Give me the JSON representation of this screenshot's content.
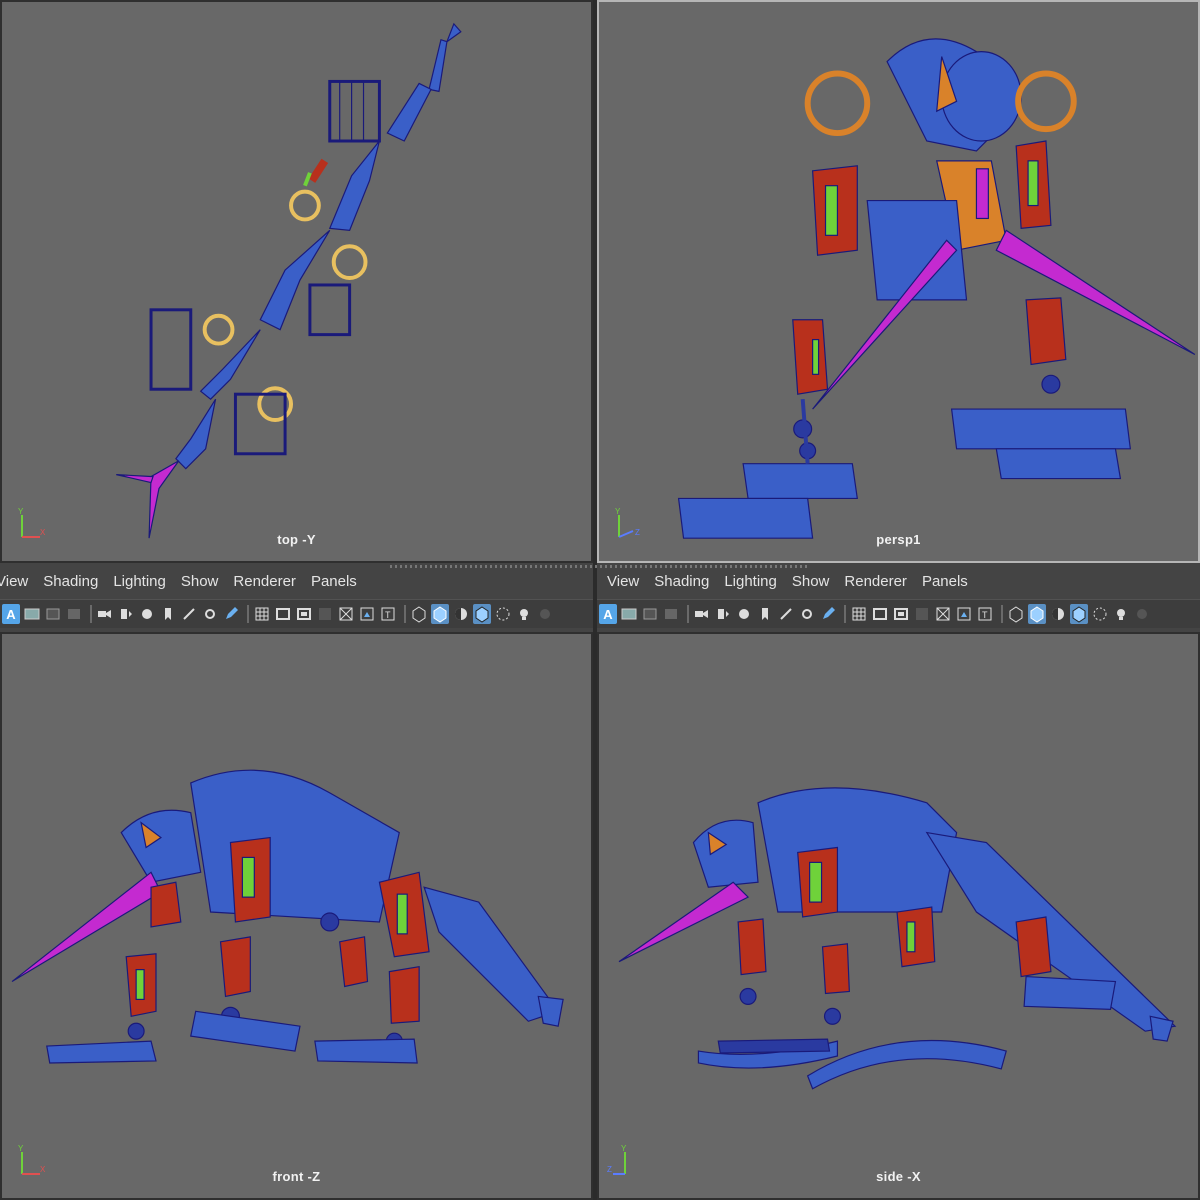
{
  "viewports": {
    "top": {
      "label": "top -Y"
    },
    "persp": {
      "label": "persp1"
    },
    "front": {
      "label": "front -Z"
    },
    "side": {
      "label": "side -X"
    }
  },
  "panel_menu": {
    "left": [
      "View",
      "Shading",
      "Lighting",
      "Show",
      "Renderer",
      "Panels"
    ],
    "right": [
      "View",
      "Shading",
      "Lighting",
      "Show",
      "Renderer",
      "Panels"
    ]
  },
  "toolbar_icons": [
    "select-camera-icon",
    "camera-attributes-icon",
    "bookmark-icon",
    "image-plane-icon",
    "2d-pan-zoom-icon",
    "grease-pencil-icon",
    "grid-icon",
    "film-gate-icon",
    "resolution-gate-icon",
    "gate-mask-icon",
    "field-chart-icon",
    "safe-action-icon",
    "safe-title-icon",
    "wireframe-icon",
    "smooth-shade-icon",
    "default-material-icon",
    "wireframe-on-shaded-icon",
    "textured-icon",
    "lights-icon",
    "shadows-icon"
  ],
  "colors": {
    "viewport_bg": "#686868",
    "mesh_blue": "#3a5fc8",
    "wire_navy": "#1a1a7a",
    "accent_red": "#b8301c",
    "accent_green": "#6fd23a",
    "accent_magenta": "#c42ad0",
    "accent_orange": "#d9822a",
    "accent_yellow": "#e8c060"
  },
  "axis_labels": {
    "y": "Y",
    "x": "X",
    "z": "Z"
  }
}
